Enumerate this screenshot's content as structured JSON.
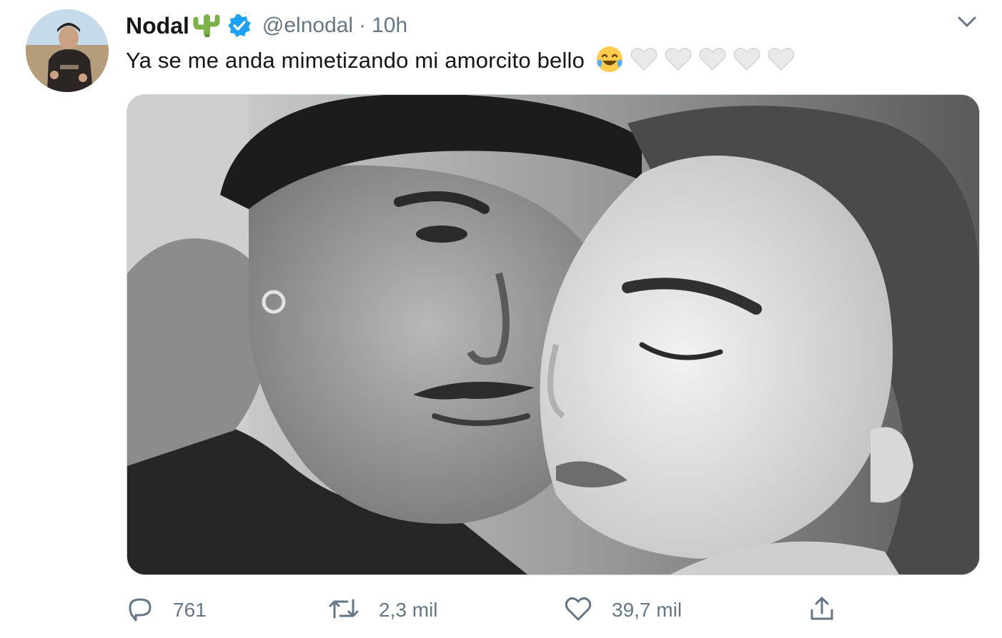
{
  "tweet": {
    "author_name": "Nodal",
    "handle": "@elnodal",
    "separator": "·",
    "time": "10h",
    "text": "Ya se me anda mimetizando mi amorcito bello",
    "emojis": [
      "face-with-tears-of-joy-icon",
      "white-heart-icon",
      "white-heart-icon",
      "white-heart-icon",
      "white-heart-icon",
      "white-heart-icon"
    ],
    "media": {
      "type": "photo",
      "tone": "black-and-white"
    }
  },
  "actions": {
    "reply_count": "761",
    "retweet_count": "2,3 mil",
    "like_count": "39,7 mil"
  },
  "colors": {
    "text_primary": "#14171a",
    "text_secondary": "#657786",
    "verified_blue": "#1da1f2",
    "cactus_green": "#7db24a"
  }
}
